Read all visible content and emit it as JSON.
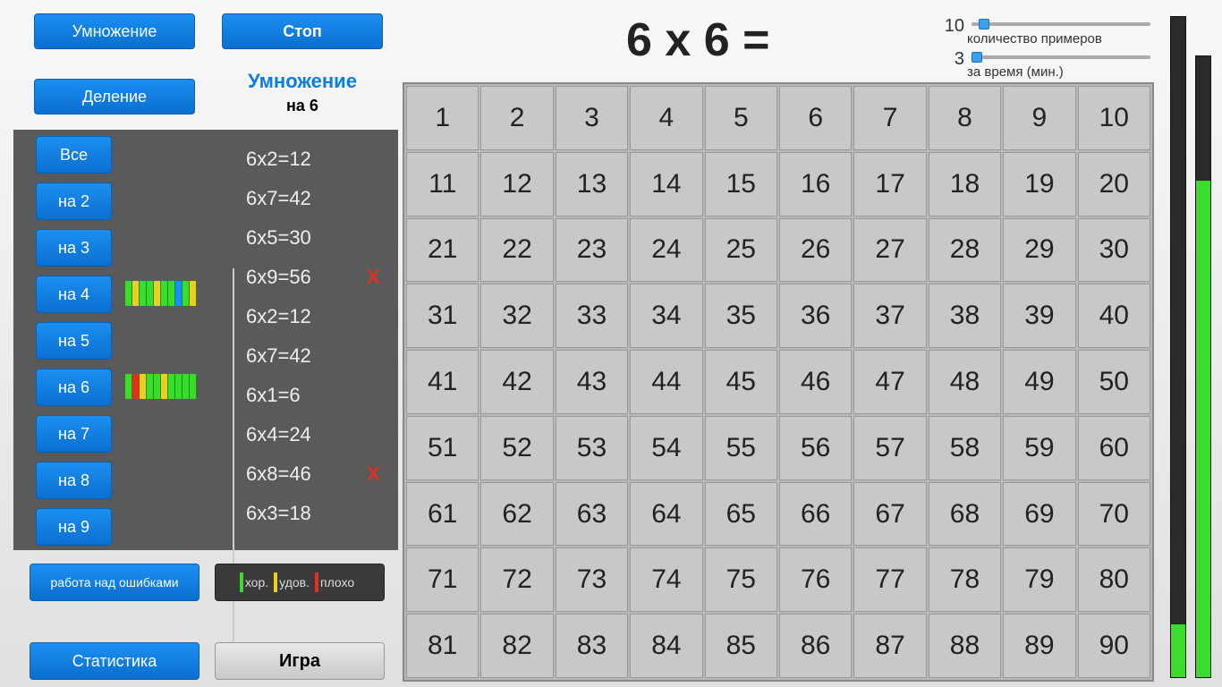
{
  "buttons": {
    "mult": "Умножение",
    "div": "Деление",
    "stop": "Стоп",
    "errors": "работа над ошибками",
    "stats": "Статистика",
    "game": "Игра"
  },
  "mode": {
    "title": "Умножение",
    "sub": "на 6"
  },
  "side_buttons": [
    "Все",
    "на 2",
    "на 3",
    "на 4",
    "на 5",
    "на 6",
    "на 7",
    "на 8",
    "на 9"
  ],
  "mini_rows": [
    {
      "index": 3,
      "colors": [
        "#3cdc2c",
        "#e8d020",
        "#3cdc2c",
        "#3cdc2c",
        "#e8d020",
        "#3cdc2c",
        "#3cdc2c",
        "#1b8ff0",
        "#3cdc2c",
        "#e8d020"
      ]
    },
    {
      "index": 5,
      "colors": [
        "#3cdc2c",
        "#e03020",
        "#e8d020",
        "#3cdc2c",
        "#3cdc2c",
        "#e8d020",
        "#3cdc2c",
        "#3cdc2c",
        "#3cdc2c",
        "#3cdc2c"
      ]
    }
  ],
  "history": [
    {
      "text": "6x2=12",
      "wrong": false
    },
    {
      "text": "6x7=42",
      "wrong": false
    },
    {
      "text": "6x5=30",
      "wrong": false
    },
    {
      "text": "6x9=56",
      "wrong": true
    },
    {
      "text": "6x2=12",
      "wrong": false
    },
    {
      "text": "6x7=42",
      "wrong": false
    },
    {
      "text": "6x1=6",
      "wrong": false
    },
    {
      "text": "6x4=24",
      "wrong": false
    },
    {
      "text": "6x8=46",
      "wrong": true
    },
    {
      "text": "6x3=18",
      "wrong": false
    }
  ],
  "legend": {
    "good": "хор.",
    "ok": "удов.",
    "bad": "плохо"
  },
  "question": "6 x 6 =",
  "grid": {
    "start": 1,
    "end": 90
  },
  "settings": {
    "count": {
      "value": "10",
      "label": "количество примеров",
      "pos": 0.07
    },
    "time": {
      "value": "3",
      "label": "за время (мин.)",
      "pos": 0.03
    }
  },
  "progress": {
    "bar1": 0.08,
    "bar2": 0.8
  },
  "wrong_mark": "X"
}
